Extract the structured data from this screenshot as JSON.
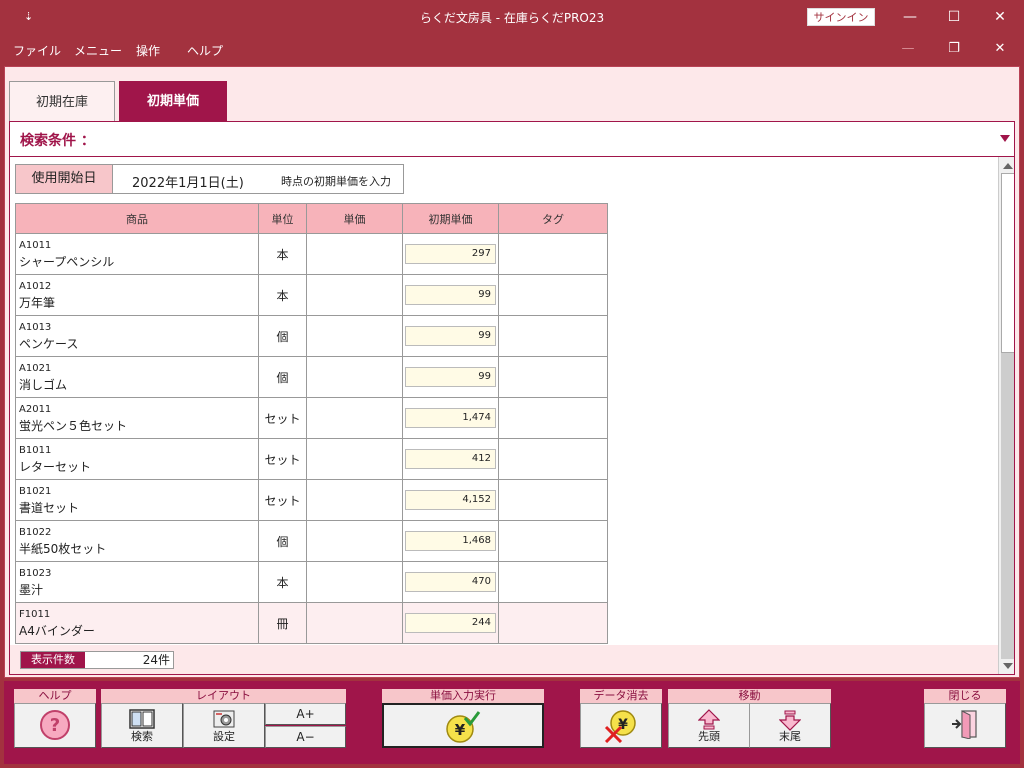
{
  "window": {
    "pin_glyph": "⇣",
    "title": "らくだ文房具 - 在庫らくだPRO23",
    "signin_label": "サインイン",
    "minimize_glyph": "—",
    "maximize_glyph": "☐",
    "close_glyph": "✕"
  },
  "menu": {
    "items": [
      "ファイル",
      "メニュー",
      "操作",
      "ヘルプ"
    ],
    "child_minimize_glyph": "—",
    "child_restore_glyph": "❐",
    "child_close_glyph": "✕"
  },
  "tabs": [
    {
      "label": "初期在庫",
      "active": false
    },
    {
      "label": "初期単価",
      "active": true
    }
  ],
  "search": {
    "label": "検索条件 ："
  },
  "start_date": {
    "label": "使用開始日",
    "value": "2022年1月1日(土)",
    "suffix": "時点の初期単価を入力"
  },
  "grid": {
    "headers": [
      "商品",
      "単位",
      "単価",
      "初期単価",
      "タグ"
    ],
    "rows": [
      {
        "code": "A1011",
        "name": "シャープペンシル",
        "unit": "本",
        "price": "",
        "initial_price": "297",
        "tag": ""
      },
      {
        "code": "A1012",
        "name": "万年筆",
        "unit": "本",
        "price": "",
        "initial_price": "99",
        "tag": ""
      },
      {
        "code": "A1013",
        "name": "ペンケース",
        "unit": "個",
        "price": "",
        "initial_price": "99",
        "tag": ""
      },
      {
        "code": "A1021",
        "name": "消しゴム",
        "unit": "個",
        "price": "",
        "initial_price": "99",
        "tag": ""
      },
      {
        "code": "A2011",
        "name": "蛍光ペン５色セット",
        "unit": "セット",
        "price": "",
        "initial_price": "1,474",
        "tag": ""
      },
      {
        "code": "B1011",
        "name": "レターセット",
        "unit": "セット",
        "price": "",
        "initial_price": "412",
        "tag": ""
      },
      {
        "code": "B1021",
        "name": "書道セット",
        "unit": "セット",
        "price": "",
        "initial_price": "4,152",
        "tag": ""
      },
      {
        "code": "B1022",
        "name": "半紙50枚セット",
        "unit": "個",
        "price": "",
        "initial_price": "1,468",
        "tag": ""
      },
      {
        "code": "B1023",
        "name": "墨汁",
        "unit": "本",
        "price": "",
        "initial_price": "470",
        "tag": ""
      },
      {
        "code": "F1011",
        "name": "A4バインダー",
        "unit": "冊",
        "price": "",
        "initial_price": "244",
        "tag": ""
      }
    ]
  },
  "count": {
    "label": "表示件数",
    "value": "24件"
  },
  "toolbar": {
    "help_group": "ヘルプ",
    "layout_group": "レイアウト",
    "search_btn": "検索",
    "settings_btn": "設定",
    "font_up": "A+",
    "font_down": "A−",
    "exec_group": "単価入力実行",
    "clear_group": "データ消去",
    "move_group": "移動",
    "first_btn": "先頭",
    "last_btn": "末尾",
    "close_group": "閉じる",
    "help_glyph": "?",
    "yen_glyph": "¥"
  },
  "colors": {
    "accent": "#a0154a",
    "titlebar": "#a3323f",
    "header_pink": "#f7b3ba",
    "panel_bg": "#fde8ea"
  }
}
